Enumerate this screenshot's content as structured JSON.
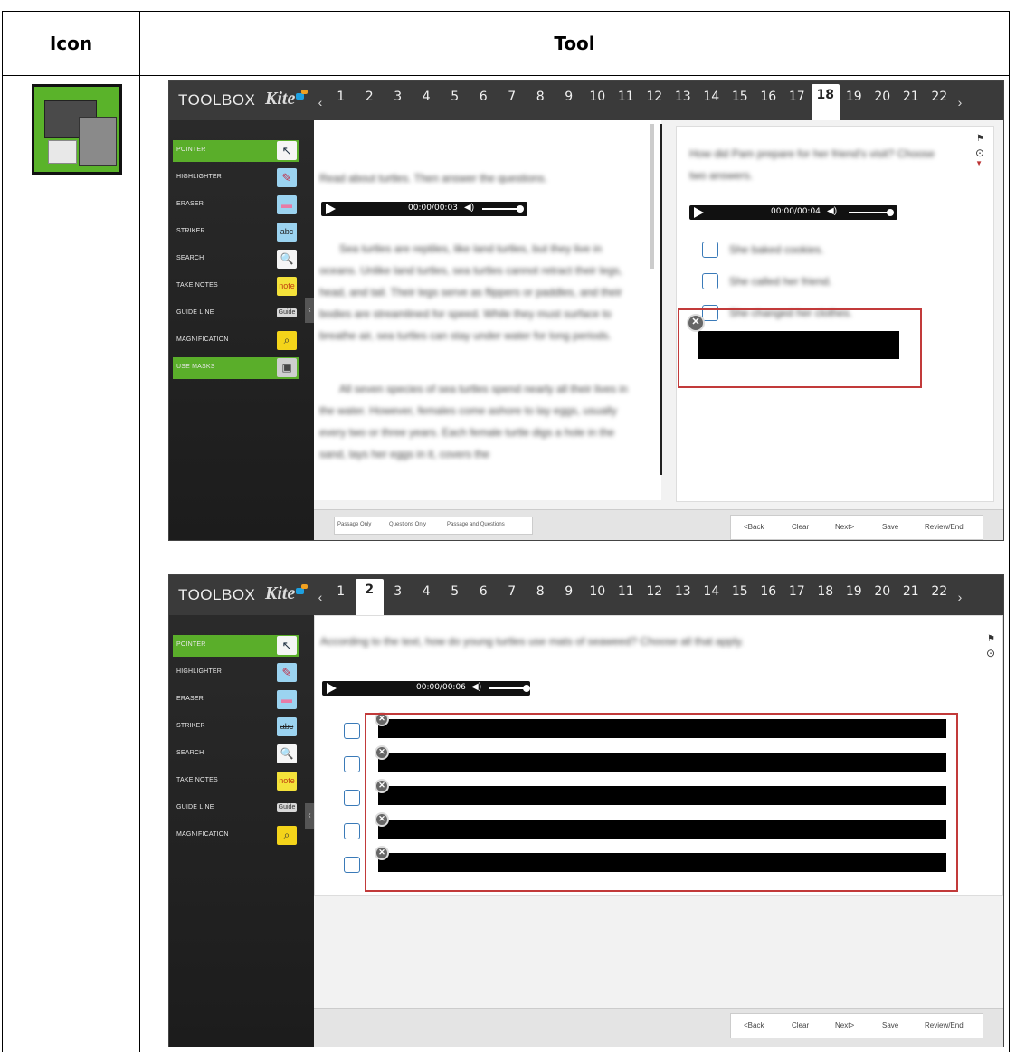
{
  "table": {
    "col_icon": "Icon",
    "col_tool": "Tool"
  },
  "app": {
    "brand": "TOOLBOX",
    "logo": "Kite"
  },
  "tools": [
    {
      "label": "POINTER",
      "icon": "pointer-icon",
      "glyph": "↖"
    },
    {
      "label": "HIGHLIGHTER",
      "icon": "highlighter-icon",
      "glyph": "✎"
    },
    {
      "label": "ERASER",
      "icon": "eraser-icon",
      "glyph": "▬"
    },
    {
      "label": "STRIKER",
      "icon": "striker-icon",
      "glyph": "abc"
    },
    {
      "label": "SEARCH",
      "icon": "search-icon",
      "glyph": "🔍"
    },
    {
      "label": "TAKE NOTES",
      "icon": "note-icon",
      "glyph": "note"
    },
    {
      "label": "GUIDE LINE",
      "icon": "guide-line-icon",
      "glyph": "Guide"
    },
    {
      "label": "MAGNIFICATION",
      "icon": "magnification-icon",
      "glyph": "⌕"
    },
    {
      "label": "USE MASKS",
      "icon": "masks-icon",
      "glyph": "▣"
    }
  ],
  "question_numbers": [
    "1",
    "2",
    "3",
    "4",
    "5",
    "6",
    "7",
    "8",
    "9",
    "10",
    "11",
    "12",
    "13",
    "14",
    "15",
    "16",
    "17",
    "18",
    "19",
    "20",
    "21",
    "22"
  ],
  "screen1": {
    "active_question": "18",
    "passage_intro": "Read about turtles. Then answer the questions.",
    "passage_audio_time": "00:00/00:03",
    "passage_p1": "Sea turtles are reptiles, like land turtles, but they live in oceans. Unlike land turtles, sea turtles cannot retract their legs, head, and tail. Their legs serve as flippers or paddles, and their bodies are streamlined for speed. While they must surface to breathe air, sea turtles can stay under water for long periods.",
    "passage_p2": "All seven species of sea turtles spend nearly all their lives in the water. However, females come ashore to lay eggs, usually every two or three years. Each female turtle digs a hole in the sand, lays her eggs in it, covers the",
    "question": "How did Pam prepare for her friend's visit? Choose two answers.",
    "question_audio_time": "00:00/00:04",
    "options": [
      "She baked cookies.",
      "She called her friend.",
      "She changed her clothes."
    ],
    "tabs": [
      "Passage Only",
      "Questions Only",
      "Passage and Questions"
    ],
    "nav": [
      "<Back",
      "Clear",
      "Next>",
      "Save",
      "Review/End"
    ]
  },
  "screen2": {
    "active_question": "2",
    "question": "According to the text, how do young turtles use mats of seaweed? Choose all that apply.",
    "question_audio_time": "00:00/00:06",
    "option_count": "5",
    "nav": [
      "<Back",
      "Clear",
      "Next>",
      "Save",
      "Review/End"
    ]
  },
  "colors": {
    "accent_green": "#5aae2a",
    "mask_highlight": "#c23a3a",
    "topbar": "#3a3a3a"
  }
}
